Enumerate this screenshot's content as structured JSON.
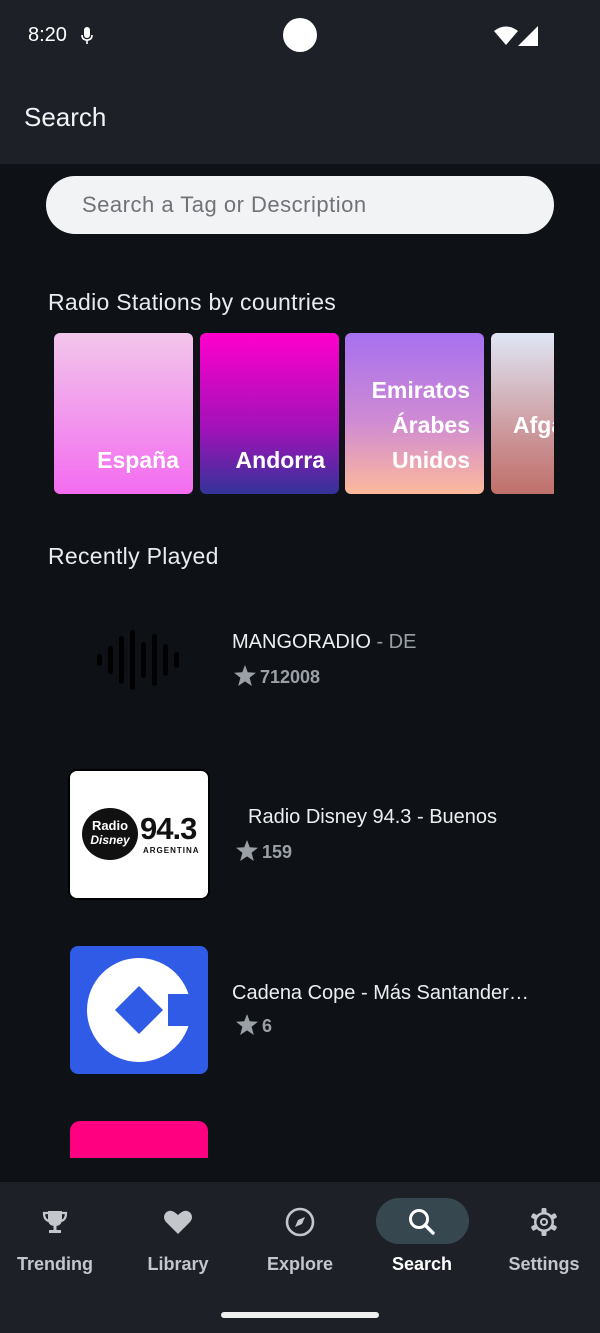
{
  "status": {
    "time": "8:20"
  },
  "appbar": {
    "title": "Search"
  },
  "search": {
    "placeholder": "Search a Tag or Description"
  },
  "countries": {
    "title": "Radio Stations by countries",
    "items": [
      {
        "name": "España",
        "gradient": [
          "#f2c6ea",
          "#f36cf0"
        ]
      },
      {
        "name": "Andorra",
        "gradient": [
          "#ff00cc",
          "#333399"
        ]
      },
      {
        "name": "Emiratos Árabes Unidos",
        "gradient": [
          "#a770ef",
          "#fdb99b"
        ]
      },
      {
        "name": "Afga",
        "gradient": [
          "#dfe6f5",
          "#c0706a"
        ]
      }
    ]
  },
  "recent": {
    "title": "Recently Played",
    "stations": [
      {
        "name": "MANGORADIO",
        "country": " - DE",
        "rating": "712008",
        "logo": "soundwave-logo"
      },
      {
        "name": "Radio Disney 94.3 - Buenos",
        "country": "",
        "rating": "159",
        "logo": "radio-disney-logo",
        "logo_text_1": "Radio",
        "logo_text_2": "Disney",
        "logo_text_3": "94.3",
        "logo_text_4": "ARGENTINA"
      },
      {
        "name": "Cadena Cope - Más Santander…",
        "country": "",
        "rating": "6",
        "logo": "cope-logo"
      }
    ]
  },
  "nav": {
    "items": [
      {
        "label": "Trending",
        "icon": "trophy-icon"
      },
      {
        "label": "Library",
        "icon": "heart-icon"
      },
      {
        "label": "Explore",
        "icon": "compass-icon"
      },
      {
        "label": "Search",
        "icon": "search-icon",
        "active": true
      },
      {
        "label": "Settings",
        "icon": "gear-icon"
      }
    ]
  },
  "colors": {
    "background": "#0e1217",
    "bars": "#1d2127",
    "active_pill": "#37474f",
    "cope_blue": "#2f5be6",
    "pink_tile": "#ff0080"
  }
}
